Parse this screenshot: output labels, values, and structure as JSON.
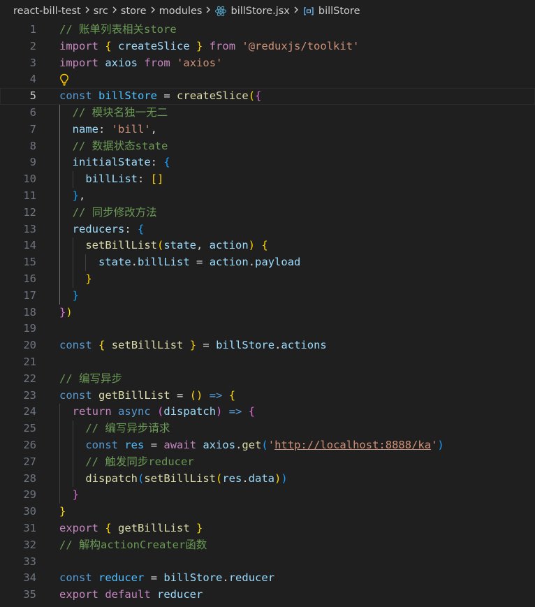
{
  "breadcrumb": {
    "items": [
      {
        "label": "react-bill-test",
        "icon": null
      },
      {
        "label": "src",
        "icon": null
      },
      {
        "label": "store",
        "icon": null
      },
      {
        "label": "modules",
        "icon": null
      },
      {
        "label": "billStore.jsx",
        "icon": "react-icon"
      },
      {
        "label": "billStore",
        "icon": "symbol-variable-icon"
      }
    ],
    "separator": ">"
  },
  "editor": {
    "current_line": 5,
    "lines": [
      {
        "n": "1",
        "indent": 0,
        "tokens": [
          [
            "c-comment",
            "// 账单列表相关store"
          ]
        ]
      },
      {
        "n": "2",
        "indent": 0,
        "tokens": [
          [
            "c-kw",
            "import"
          ],
          [
            "c-punc",
            " "
          ],
          [
            "c-b1",
            "{"
          ],
          [
            "c-punc",
            " "
          ],
          [
            "c-var",
            "createSlice"
          ],
          [
            "c-punc",
            " "
          ],
          [
            "c-b1",
            "}"
          ],
          [
            "c-punc",
            " "
          ],
          [
            "c-kw",
            "from"
          ],
          [
            "c-punc",
            " "
          ],
          [
            "c-str",
            "'@reduxjs/toolkit'"
          ]
        ]
      },
      {
        "n": "3",
        "indent": 0,
        "tokens": [
          [
            "c-kw",
            "import"
          ],
          [
            "c-punc",
            " "
          ],
          [
            "c-var",
            "axios"
          ],
          [
            "c-punc",
            " "
          ],
          [
            "c-kw",
            "from"
          ],
          [
            "c-punc",
            " "
          ],
          [
            "c-str",
            "'axios'"
          ]
        ]
      },
      {
        "n": "4",
        "indent": 0,
        "tokens": [],
        "bulb": true
      },
      {
        "n": "5",
        "indent": 0,
        "tokens": [
          [
            "c-storage",
            "const"
          ],
          [
            "c-punc",
            " "
          ],
          [
            "c-const",
            "billStore"
          ],
          [
            "c-punc",
            " "
          ],
          [
            "c-op",
            "="
          ],
          [
            "c-punc",
            " "
          ],
          [
            "c-func",
            "createSlice"
          ],
          [
            "c-b1",
            "("
          ],
          [
            "c-b2",
            "{"
          ]
        ]
      },
      {
        "n": "6",
        "indent": 1,
        "tokens": [
          [
            "c-comment",
            "// 模块名独一无二"
          ]
        ]
      },
      {
        "n": "7",
        "indent": 1,
        "tokens": [
          [
            "c-var",
            "name"
          ],
          [
            "c-punc",
            ": "
          ],
          [
            "c-str",
            "'bill'"
          ],
          [
            "c-punc",
            ","
          ]
        ]
      },
      {
        "n": "8",
        "indent": 1,
        "tokens": [
          [
            "c-comment",
            "// 数据状态state"
          ]
        ]
      },
      {
        "n": "9",
        "indent": 1,
        "tokens": [
          [
            "c-var",
            "initialState"
          ],
          [
            "c-punc",
            ": "
          ],
          [
            "c-b3",
            "{"
          ]
        ]
      },
      {
        "n": "10",
        "indent": 2,
        "tokens": [
          [
            "c-var",
            "billList"
          ],
          [
            "c-punc",
            ": "
          ],
          [
            "c-b1",
            "[]"
          ]
        ]
      },
      {
        "n": "11",
        "indent": 1,
        "tokens": [
          [
            "c-b3",
            "}"
          ],
          [
            "c-punc",
            ","
          ]
        ]
      },
      {
        "n": "12",
        "indent": 1,
        "tokens": [
          [
            "c-comment",
            "// 同步修改方法"
          ]
        ]
      },
      {
        "n": "13",
        "indent": 1,
        "tokens": [
          [
            "c-var",
            "reducers"
          ],
          [
            "c-punc",
            ": "
          ],
          [
            "c-b3",
            "{"
          ]
        ]
      },
      {
        "n": "14",
        "indent": 2,
        "tokens": [
          [
            "c-func",
            "setBillList"
          ],
          [
            "c-b1",
            "("
          ],
          [
            "c-var",
            "state"
          ],
          [
            "c-punc",
            ", "
          ],
          [
            "c-var",
            "action"
          ],
          [
            "c-b1",
            ")"
          ],
          [
            "c-punc",
            " "
          ],
          [
            "c-b1",
            "{"
          ]
        ]
      },
      {
        "n": "15",
        "indent": 3,
        "tokens": [
          [
            "c-var",
            "state"
          ],
          [
            "c-punc",
            "."
          ],
          [
            "c-var",
            "billList"
          ],
          [
            "c-punc",
            " "
          ],
          [
            "c-op",
            "="
          ],
          [
            "c-punc",
            " "
          ],
          [
            "c-var",
            "action"
          ],
          [
            "c-punc",
            "."
          ],
          [
            "c-var",
            "payload"
          ]
        ]
      },
      {
        "n": "16",
        "indent": 2,
        "tokens": [
          [
            "c-b1",
            "}"
          ]
        ]
      },
      {
        "n": "17",
        "indent": 1,
        "tokens": [
          [
            "c-b3",
            "}"
          ]
        ]
      },
      {
        "n": "18",
        "indent": 0,
        "tokens": [
          [
            "c-b2",
            "}"
          ],
          [
            "c-b1",
            ")"
          ]
        ]
      },
      {
        "n": "19",
        "indent": 0,
        "tokens": []
      },
      {
        "n": "20",
        "indent": 0,
        "tokens": [
          [
            "c-storage",
            "const"
          ],
          [
            "c-punc",
            " "
          ],
          [
            "c-b1",
            "{"
          ],
          [
            "c-punc",
            " "
          ],
          [
            "c-func",
            "setBillList"
          ],
          [
            "c-punc",
            " "
          ],
          [
            "c-b1",
            "}"
          ],
          [
            "c-punc",
            " "
          ],
          [
            "c-op",
            "="
          ],
          [
            "c-punc",
            " "
          ],
          [
            "c-var",
            "billStore"
          ],
          [
            "c-punc",
            "."
          ],
          [
            "c-var",
            "actions"
          ]
        ]
      },
      {
        "n": "21",
        "indent": 0,
        "tokens": []
      },
      {
        "n": "22",
        "indent": 0,
        "tokens": [
          [
            "c-comment",
            "// 编写异步"
          ]
        ]
      },
      {
        "n": "23",
        "indent": 0,
        "tokens": [
          [
            "c-storage",
            "const"
          ],
          [
            "c-punc",
            " "
          ],
          [
            "c-func",
            "getBillList"
          ],
          [
            "c-punc",
            " "
          ],
          [
            "c-op",
            "="
          ],
          [
            "c-punc",
            " "
          ],
          [
            "c-b1",
            "()"
          ],
          [
            "c-punc",
            " "
          ],
          [
            "c-storage",
            "=>"
          ],
          [
            "c-punc",
            " "
          ],
          [
            "c-b1",
            "{"
          ]
        ]
      },
      {
        "n": "24",
        "indent": 1,
        "tokens": [
          [
            "c-kw",
            "return"
          ],
          [
            "c-punc",
            " "
          ],
          [
            "c-storage",
            "async"
          ],
          [
            "c-punc",
            " "
          ],
          [
            "c-b2",
            "("
          ],
          [
            "c-var",
            "dispatch"
          ],
          [
            "c-b2",
            ")"
          ],
          [
            "c-punc",
            " "
          ],
          [
            "c-storage",
            "=>"
          ],
          [
            "c-punc",
            " "
          ],
          [
            "c-b2",
            "{"
          ]
        ]
      },
      {
        "n": "25",
        "indent": 2,
        "tokens": [
          [
            "c-comment",
            "// 编写异步请求"
          ]
        ]
      },
      {
        "n": "26",
        "indent": 2,
        "tokens": [
          [
            "c-storage",
            "const"
          ],
          [
            "c-punc",
            " "
          ],
          [
            "c-const",
            "res"
          ],
          [
            "c-punc",
            " "
          ],
          [
            "c-op",
            "="
          ],
          [
            "c-punc",
            " "
          ],
          [
            "c-kw",
            "await"
          ],
          [
            "c-punc",
            " "
          ],
          [
            "c-var",
            "axios"
          ],
          [
            "c-punc",
            "."
          ],
          [
            "c-func",
            "get"
          ],
          [
            "c-b3",
            "("
          ],
          [
            "c-str",
            "'"
          ],
          [
            "c-url",
            "http://localhost:8888/ka"
          ],
          [
            "c-str",
            "'"
          ],
          [
            "c-b3",
            ")"
          ]
        ]
      },
      {
        "n": "27",
        "indent": 2,
        "tokens": [
          [
            "c-comment",
            "// 触发同步reducer"
          ]
        ]
      },
      {
        "n": "28",
        "indent": 2,
        "tokens": [
          [
            "c-func",
            "dispatch"
          ],
          [
            "c-b3",
            "("
          ],
          [
            "c-func",
            "setBillList"
          ],
          [
            "c-b1",
            "("
          ],
          [
            "c-var",
            "res"
          ],
          [
            "c-punc",
            "."
          ],
          [
            "c-var",
            "data"
          ],
          [
            "c-b1",
            ")"
          ],
          [
            "c-b3",
            ")"
          ]
        ]
      },
      {
        "n": "29",
        "indent": 1,
        "tokens": [
          [
            "c-b2",
            "}"
          ]
        ]
      },
      {
        "n": "30",
        "indent": 0,
        "tokens": [
          [
            "c-b1",
            "}"
          ]
        ]
      },
      {
        "n": "31",
        "indent": 0,
        "tokens": [
          [
            "c-kw",
            "export"
          ],
          [
            "c-punc",
            " "
          ],
          [
            "c-b1",
            "{"
          ],
          [
            "c-punc",
            " "
          ],
          [
            "c-func",
            "getBillList"
          ],
          [
            "c-punc",
            " "
          ],
          [
            "c-b1",
            "}"
          ]
        ]
      },
      {
        "n": "32",
        "indent": 0,
        "tokens": [
          [
            "c-comment",
            "// 解构actionCreater函数"
          ]
        ]
      },
      {
        "n": "33",
        "indent": 0,
        "tokens": []
      },
      {
        "n": "34",
        "indent": 0,
        "tokens": [
          [
            "c-storage",
            "const"
          ],
          [
            "c-punc",
            " "
          ],
          [
            "c-const",
            "reducer"
          ],
          [
            "c-punc",
            " "
          ],
          [
            "c-op",
            "="
          ],
          [
            "c-punc",
            " "
          ],
          [
            "c-var",
            "billStore"
          ],
          [
            "c-punc",
            "."
          ],
          [
            "c-var",
            "reducer"
          ]
        ]
      },
      {
        "n": "35",
        "indent": 0,
        "tokens": [
          [
            "c-kw",
            "export"
          ],
          [
            "c-punc",
            " "
          ],
          [
            "c-kw",
            "default"
          ],
          [
            "c-punc",
            " "
          ],
          [
            "c-var",
            "reducer"
          ]
        ]
      }
    ]
  },
  "colors": {
    "background": "#1f1f1f",
    "comment": "#6a9955",
    "keyword": "#c586c0",
    "storage": "#569cd6",
    "function": "#dcdcaa",
    "variable": "#9cdcfe",
    "string": "#ce9178",
    "bracket_gold": "#ffd700",
    "bracket_orchid": "#da70d6",
    "bracket_blue": "#179fff",
    "lightbulb": "#ffcc00"
  }
}
